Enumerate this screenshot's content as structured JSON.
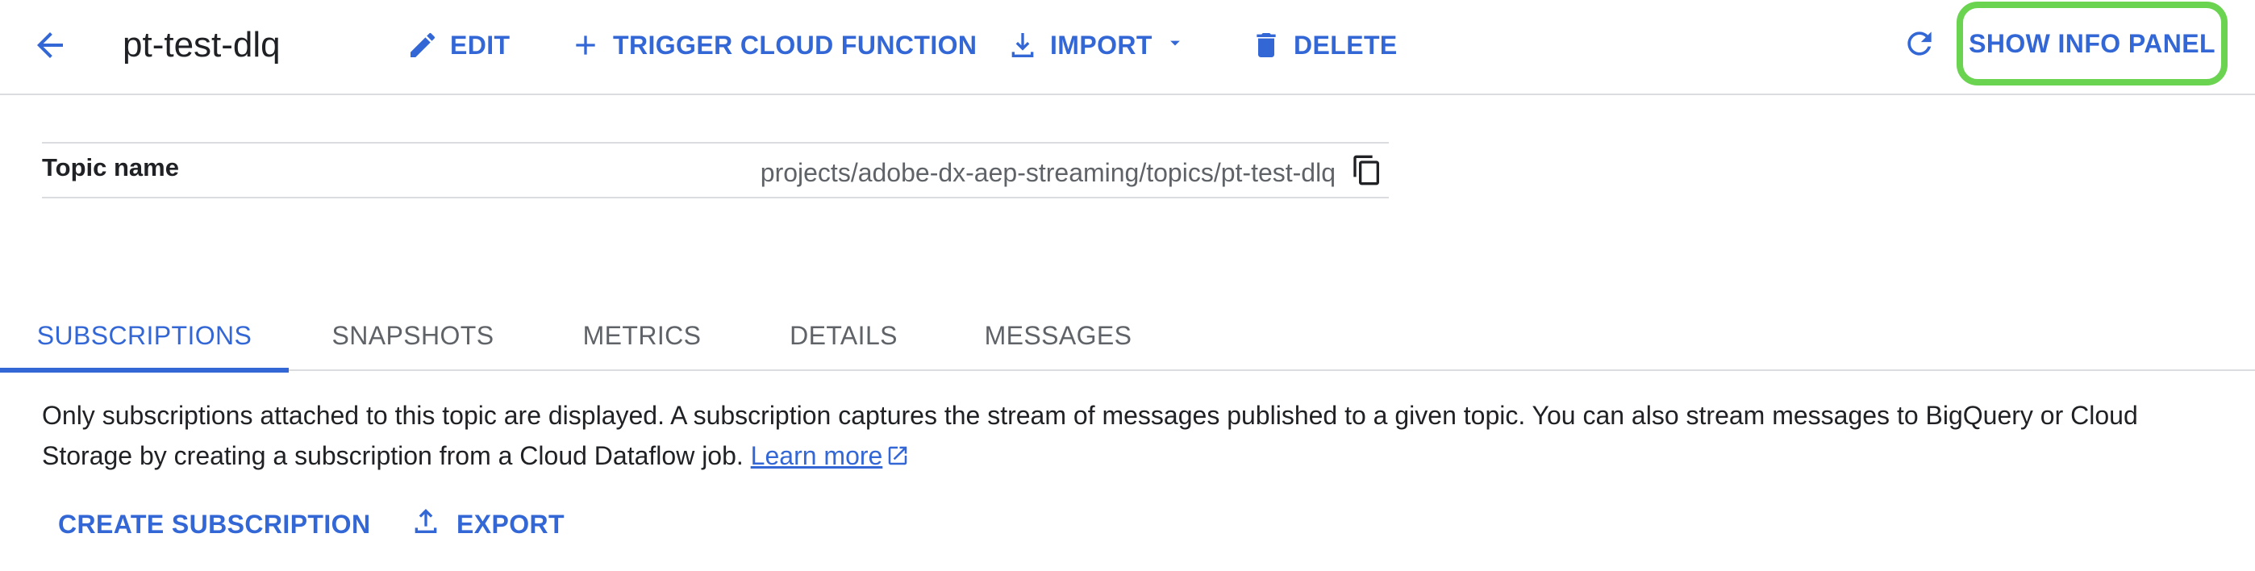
{
  "header": {
    "title": "pt-test-dlq",
    "edit_label": "EDIT",
    "trigger_label": "TRIGGER CLOUD FUNCTION",
    "import_label": "IMPORT",
    "delete_label": "DELETE",
    "info_panel_label": "SHOW INFO PANEL"
  },
  "topic": {
    "label": "Topic name",
    "value": "projects/adobe-dx-aep-streaming/topics/pt-test-dlq"
  },
  "tabs": [
    {
      "label": "SUBSCRIPTIONS",
      "active": true
    },
    {
      "label": "SNAPSHOTS",
      "active": false
    },
    {
      "label": "METRICS",
      "active": false
    },
    {
      "label": "DETAILS",
      "active": false
    },
    {
      "label": "MESSAGES",
      "active": false
    }
  ],
  "description": {
    "text": "Only subscriptions attached to this topic are displayed. A subscription captures the stream of messages published to a given topic. You can also stream messages to BigQuery or Cloud Storage by creating a subscription from a Cloud Dataflow job.",
    "link_label": "Learn more"
  },
  "actions": {
    "create_label": "CREATE SUBSCRIPTION",
    "export_label": "EXPORT"
  },
  "icons": {
    "back": "arrow-back-icon",
    "edit": "pencil-icon",
    "trigger": "plus-icon",
    "import": "download-icon",
    "import_menu": "caret-down-icon",
    "delete": "trash-icon",
    "refresh": "refresh-icon",
    "copy": "copy-icon",
    "external": "external-link-icon",
    "export": "upload-icon"
  },
  "colors": {
    "accent": "#3367d6",
    "highlight": "#6ad34f",
    "divider": "#dadce0"
  }
}
